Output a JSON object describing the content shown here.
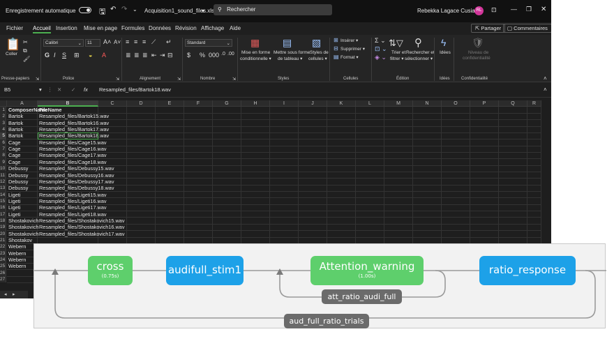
{
  "titlebar": {
    "autosave": "Enregistrement automatique",
    "filename": "Acquisition1_sound_files.xlsx",
    "filename_caret": "▾",
    "search": "Rechercher",
    "user": "Rebekka Lagace Cusiac",
    "user_initials": "RL"
  },
  "menu": {
    "items": [
      "Fichier",
      "Accueil",
      "Insertion",
      "Mise en page",
      "Formules",
      "Données",
      "Révision",
      "Affichage",
      "Aide"
    ],
    "share": "Partager",
    "comments": "Commentaires"
  },
  "ribbon": {
    "coller": "Coller",
    "font_name": "Calibri",
    "font_size": "11",
    "number_format": "Standard",
    "cond_format_1": "Mise en forme",
    "cond_format_2": "conditionnelle ▾",
    "table_format_1": "Mettre sous forme",
    "table_format_2": "de tableau ▾",
    "cell_styles_1": "Styles de",
    "cell_styles_2": "cellules ▾",
    "insert": "Insérer ▾",
    "delete": "Supprimer ▾",
    "format": "Format ▾",
    "sort_1": "Trier et",
    "sort_2": "filtrer ▾",
    "find_1": "Rechercher et",
    "find_2": "sélectionner ▾",
    "ideas": "Idées",
    "sensitivity_1": "Niveau de",
    "sensitivity_2": "confidentialité",
    "groups": {
      "clipboard": "Presse-papiers",
      "font": "Police",
      "alignment": "Alignement",
      "number": "Nombre",
      "styles": "Styles",
      "cells": "Cellules",
      "editing": "Édition",
      "ideas": "Idées",
      "sensitivity": "Confidentialité"
    }
  },
  "formula": {
    "name_box": "B5",
    "fx": "fx",
    "content": "Resampled_files/Bartok18.wav"
  },
  "sheet": {
    "columns": [
      "A",
      "B",
      "C",
      "D",
      "E",
      "F",
      "G",
      "H",
      "I",
      "J",
      "K",
      "L",
      "M",
      "N",
      "O",
      "P",
      "Q",
      "R"
    ],
    "rows": [
      [
        "ComposerName",
        "FileName"
      ],
      [
        "Bartok",
        "Resampled_files/Bartok15.wav"
      ],
      [
        "Bartok",
        "Resampled_files/Bartok16.wav"
      ],
      [
        "Bartok",
        "Resampled_files/Bartok17.wav"
      ],
      [
        "Bartok",
        "Resampled_files/Bartok18.wav"
      ],
      [
        "Cage",
        "Resampled_files/Cage15.wav"
      ],
      [
        "Cage",
        "Resampled_files/Cage16.wav"
      ],
      [
        "Cage",
        "Resampled_files/Cage17.wav"
      ],
      [
        "Cage",
        "Resampled_files/Cage18.wav"
      ],
      [
        "Debussy",
        "Resampled_files/Debussy15.wav"
      ],
      [
        "Debussy",
        "Resampled_files/Debussy16.wav"
      ],
      [
        "Debussy",
        "Resampled_files/Debussy17.wav"
      ],
      [
        "Debussy",
        "Resampled_files/Debussy18.wav"
      ],
      [
        "Ligeti",
        "Resampled_files/Ligeti15.wav"
      ],
      [
        "Ligeti",
        "Resampled_files/Ligeti16.wav"
      ],
      [
        "Ligeti",
        "Resampled_files/Ligeti17.wav"
      ],
      [
        "Ligeti",
        "Resampled_files/Ligeti18.wav"
      ],
      [
        "Shostakovich",
        "Resampled_files/Shostakovich15.wav"
      ],
      [
        "Shostakovich",
        "Resampled_files/Shostakovich16.wav"
      ],
      [
        "Shostakovich",
        "Resampled_files/Shostakovich17.wav"
      ],
      [
        "Shostakov",
        ""
      ],
      [
        "Webern",
        ""
      ],
      [
        "Webern",
        ""
      ],
      [
        "Webern",
        ""
      ],
      [
        "Webern",
        ""
      ],
      [
        "",
        ""
      ],
      [
        "",
        ""
      ]
    ],
    "selected_cell": "B5"
  },
  "flow": {
    "nodes": [
      {
        "name": "cross",
        "sub": "(0.75s)",
        "kind": "routine-green"
      },
      {
        "name": "audifull_stim1",
        "sub": "",
        "kind": "routine-blue"
      },
      {
        "name": "Attention_warning",
        "sub": "(1.00s)",
        "kind": "routine-green"
      },
      {
        "name": "ratio_response",
        "sub": "",
        "kind": "routine-blue"
      }
    ],
    "loops": [
      {
        "name": "att_ratio_audi_full"
      },
      {
        "name": "aud_full_ratio_trials"
      }
    ],
    "colors": {
      "routine_green": "#5ecf6c",
      "routine_blue": "#1da1e8",
      "loop": "#6b6b6b",
      "line": "#9a9a9a"
    }
  }
}
